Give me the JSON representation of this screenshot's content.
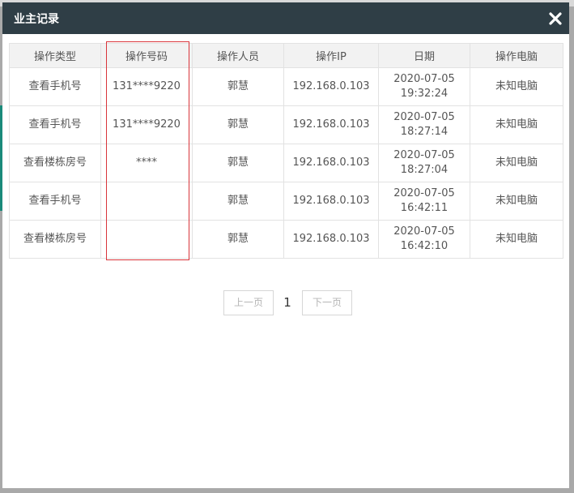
{
  "modal": {
    "title": "业主记录",
    "close_icon": "close-icon"
  },
  "table": {
    "columns": [
      "操作类型",
      "操作号码",
      "操作人员",
      "操作IP",
      "日期",
      "操作电脑"
    ],
    "rows": [
      {
        "type": "查看手机号",
        "number": "131****9220",
        "operator": "郭慧",
        "ip": "192.168.0.103",
        "date": "2020-07-05",
        "time": "19:32:24",
        "computer": "未知电脑"
      },
      {
        "type": "查看手机号",
        "number": "131****9220",
        "operator": "郭慧",
        "ip": "192.168.0.103",
        "date": "2020-07-05",
        "time": "18:27:14",
        "computer": "未知电脑"
      },
      {
        "type": "查看楼栋房号",
        "number": "****",
        "operator": "郭慧",
        "ip": "192.168.0.103",
        "date": "2020-07-05",
        "time": "18:27:04",
        "computer": "未知电脑"
      },
      {
        "type": "查看手机号",
        "number": "",
        "operator": "郭慧",
        "ip": "192.168.0.103",
        "date": "2020-07-05",
        "time": "16:42:11",
        "computer": "未知电脑"
      },
      {
        "type": "查看楼栋房号",
        "number": "",
        "operator": "郭慧",
        "ip": "192.168.0.103",
        "date": "2020-07-05",
        "time": "16:42:10",
        "computer": "未知电脑"
      }
    ]
  },
  "pagination": {
    "prev_label": "上一页",
    "current_page": "1",
    "next_label": "下一页"
  },
  "colors": {
    "header_bg": "#2f3e46",
    "highlight": "#d9343a"
  }
}
